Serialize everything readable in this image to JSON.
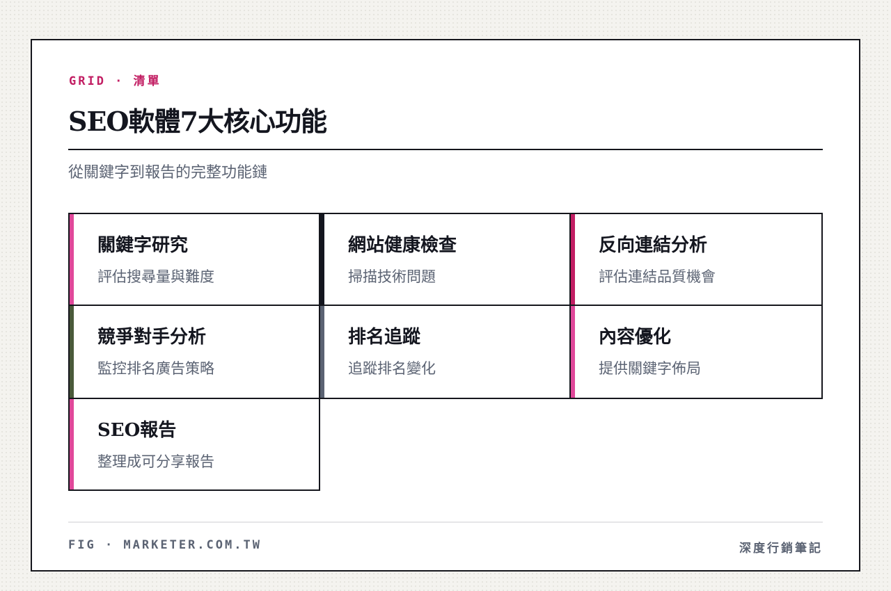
{
  "header": {
    "eyebrow": "GRID · 清單",
    "title": "SEO軟體7大核心功能",
    "subtitle": "從關鍵字到報告的完整功能鏈"
  },
  "items": [
    {
      "title": "關鍵字研究",
      "desc": "評估搜尋量與難度",
      "accent": "#e0489a"
    },
    {
      "title": "網站健康檢查",
      "desc": "掃描技術問題",
      "accent": "#14161f"
    },
    {
      "title": "反向連結分析",
      "desc": "評估連結品質機會",
      "accent": "#c21e63"
    },
    {
      "title": "競爭對手分析",
      "desc": "監控排名廣告策略",
      "accent": "#4a5a3a"
    },
    {
      "title": "排名追蹤",
      "desc": "追蹤排名變化",
      "accent": "#5b6373"
    },
    {
      "title": "內容優化",
      "desc": "提供關鍵字佈局",
      "accent": "#e0489a"
    },
    {
      "title": "SEO報告",
      "desc": "整理成可分享報告",
      "accent": "#e0489a"
    }
  ],
  "footer": {
    "left": "FIG · MARKETER.COM.TW",
    "right": "深度行銷筆記"
  }
}
